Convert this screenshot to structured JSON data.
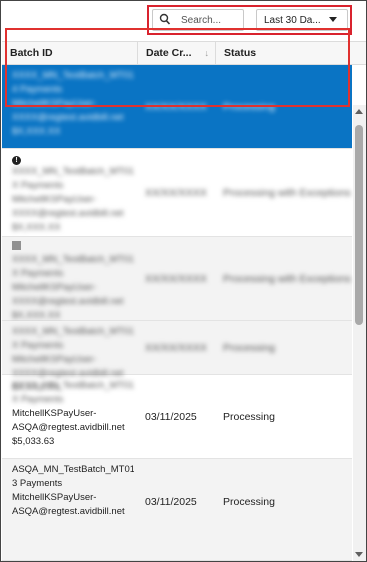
{
  "toolbar": {
    "search_placeholder": "Search...",
    "date_filter_value": "Last 30 Da...",
    "highlight_color": "#d9232e"
  },
  "table": {
    "columns": [
      "Batch ID",
      "Date Cr...",
      "Status"
    ],
    "selected_color": "#0a74c4",
    "rows": [
      {
        "redacted": true,
        "selected": true,
        "batch_lines": [
          "XXXX_MN_TestBatch_MT010",
          "4 Payments",
          "MitchellKSPayUser-",
          "XXXX@regtest.avidbill.net",
          "$X,XXX.XX"
        ],
        "date": "XX/XX/XXXX",
        "status": "Processing"
      },
      {
        "redacted": true,
        "icon": "alert-circle-icon",
        "batch_lines": [
          "XXXX_MN_TestBatch_MT010",
          "X Payments",
          "MitchellKSPayUser-",
          "XXXX@regtest.avidbill.net",
          "$X,XXX.XX"
        ],
        "date": "XX/XX/XXXX",
        "status": "Processing with Exceptions"
      },
      {
        "redacted": true,
        "icon": "document-icon",
        "batch_lines": [
          "XXXX_MN_TestBatch_MT010",
          "X Payments",
          "MitchellKSPayUser-",
          "XXXX@regtest.avidbill.net",
          "$X,XXX.XX"
        ],
        "date": "XX/XX/XXXX",
        "status": "Processing with Exceptions"
      },
      {
        "redacted": true,
        "batch_lines": [
          "XXXX_MN_TestBatch_MT010",
          "X Payments",
          "MitchellKSPayUser-",
          "XXXX@regtest.avidbill.net",
          "$X,XXX.XX"
        ],
        "date": "XX/XX/XXXX",
        "status": "Processing"
      },
      {
        "redacted": false,
        "batch_lines": [
          "XXXX_MN_TestBatch_MT010",
          "X Payments",
          "MitchellKSPayUser-",
          "ASQA@regtest.avidbill.net",
          "$5,033.63"
        ],
        "date": "03/11/2025",
        "status": "Processing"
      },
      {
        "redacted": false,
        "batch_lines": [
          "ASQA_MN_TestBatch_MT010",
          "3 Payments",
          "MitchellKSPayUser-",
          "ASQA@regtest.avidbill.net"
        ],
        "date": "03/11/2025",
        "status": "Processing"
      }
    ]
  }
}
